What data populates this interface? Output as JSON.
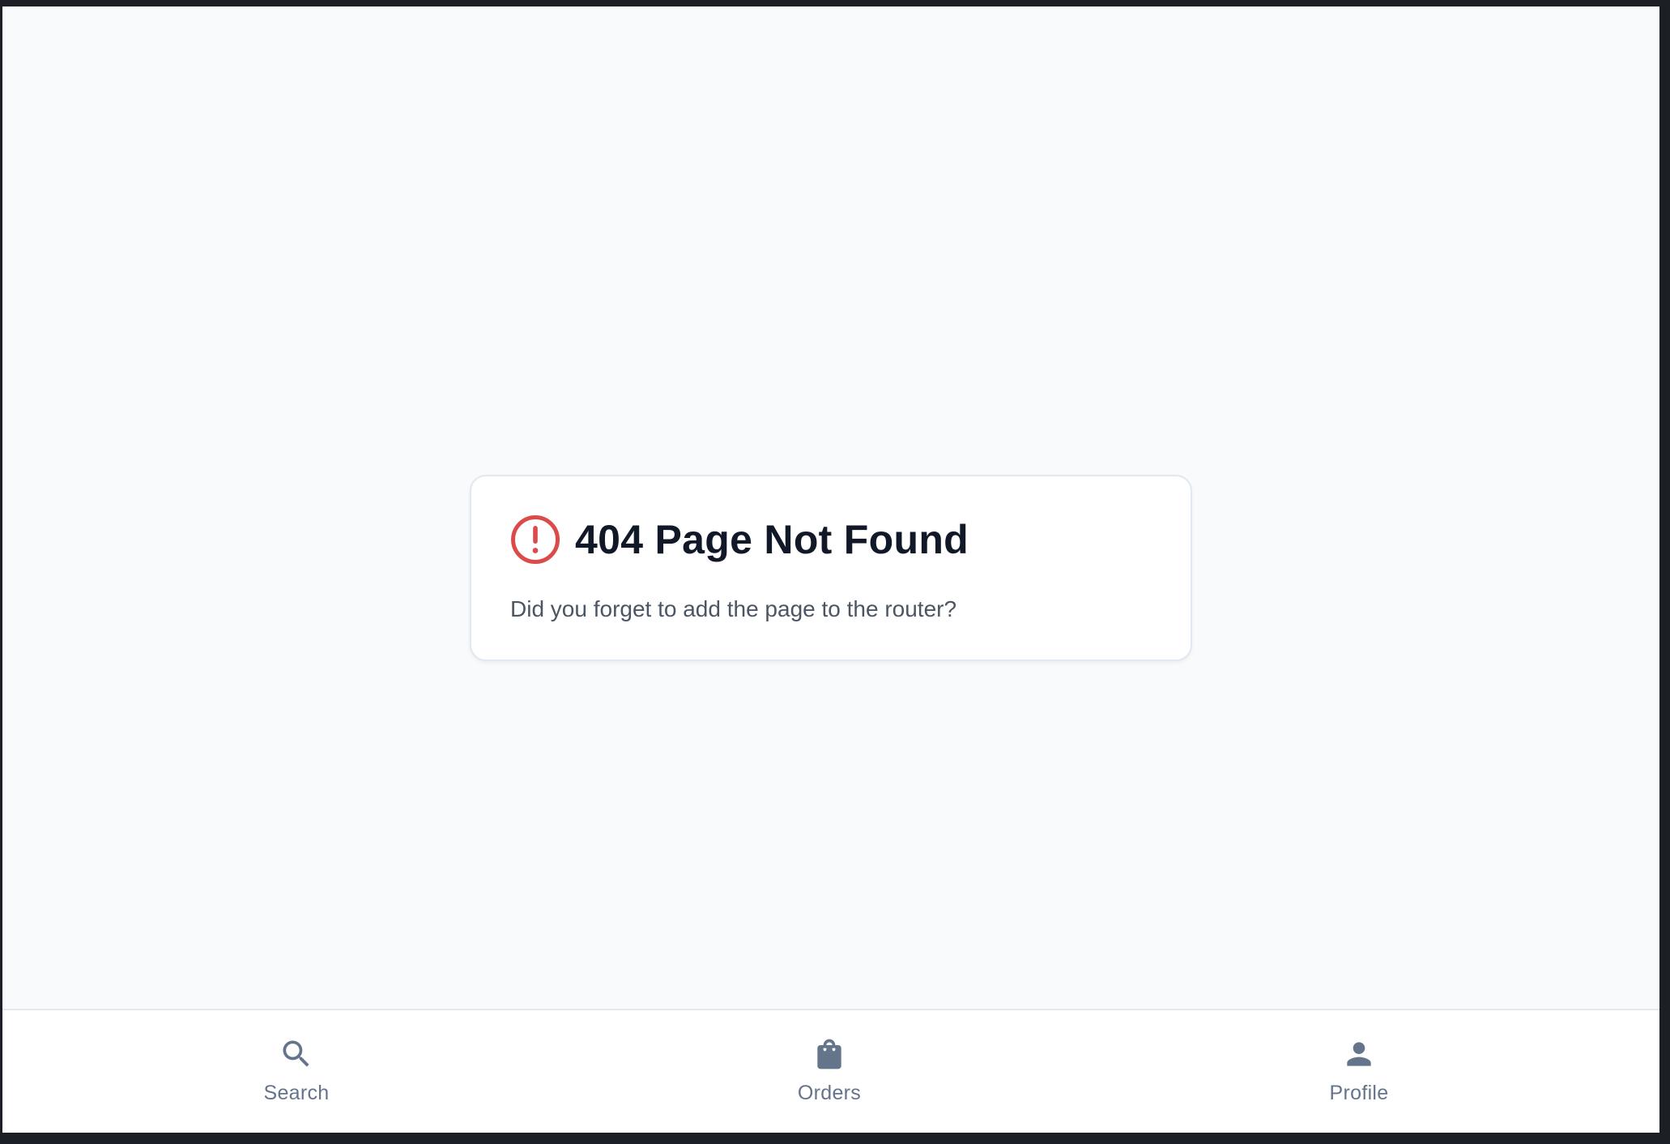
{
  "error": {
    "title": "404 Page Not Found",
    "message": "Did you forget to add the page to the router?",
    "icon": "alert-circle-icon",
    "icon_color": "#dc4a4a"
  },
  "bottom_nav": {
    "items": [
      {
        "label": "Search",
        "icon": "search-icon"
      },
      {
        "label": "Orders",
        "icon": "shopping-bag-icon"
      },
      {
        "label": "Profile",
        "icon": "user-icon"
      }
    ],
    "icon_color": "#64748b"
  },
  "colors": {
    "background": "#f8fafc",
    "card": "#ffffff",
    "title": "#111827",
    "message": "#4b5563",
    "nav_label": "#64748b"
  }
}
